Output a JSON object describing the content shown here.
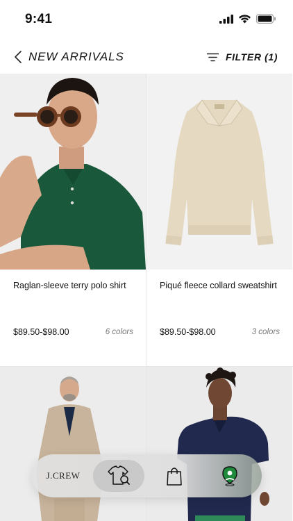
{
  "status": {
    "time": "9:41"
  },
  "header": {
    "title": "NEW ARRIVALS",
    "filter_label": "FILTER (1)"
  },
  "products": [
    {
      "name": "Raglan-sleeve terry polo shirt",
      "price": "$89.50-$98.00",
      "colors": "6 colors"
    },
    {
      "name": "Piqué fleece collard sweatshirt",
      "price": "$89.50-$98.00",
      "colors": "3 colors"
    }
  ],
  "tabbar": {
    "logo": "J.CREW",
    "active_tab": "shop"
  },
  "icons": {
    "back": "chevron-left-icon",
    "filter": "filter-lines-icon",
    "shop": "shirt-search-icon",
    "bag": "shopping-bag-icon",
    "store": "location-pin-icon"
  },
  "colors": {
    "accent_green": "#1f8a3b",
    "divider": "#e6e6e6"
  }
}
